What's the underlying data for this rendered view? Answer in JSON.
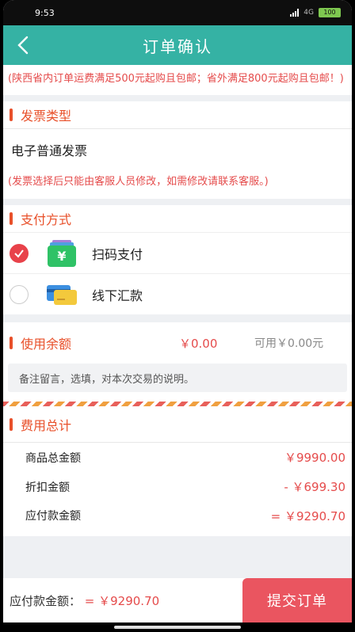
{
  "status": {
    "time": "9:53",
    "network": "4G",
    "battery": "100"
  },
  "header": {
    "title": "订单确认"
  },
  "notice": "(陕西省内订单运费满足500元起购且包邮；省外满足800元起购且包邮！)",
  "invoice": {
    "section_title": "发票类型",
    "type": "电子普通发票",
    "note": "(发票选择后只能由客服人员修改，如需修改请联系客服。)"
  },
  "payment": {
    "section_title": "支付方式",
    "methods": [
      {
        "label": "扫码支付",
        "icon": "yuan-wallet-icon",
        "selected": true
      },
      {
        "label": "线下汇款",
        "icon": "bank-card-icon",
        "selected": false
      }
    ]
  },
  "balance": {
    "label": "使用余额",
    "used": "￥0.00",
    "available": "可用￥0.00元",
    "remark_placeholder": "备注留言，选填，对本次交易的说明。"
  },
  "totals": {
    "section_title": "费用总计",
    "rows": [
      {
        "label": "商品总金额",
        "value": "￥9990.00"
      },
      {
        "label": "折扣金额",
        "value": "- ￥699.30"
      },
      {
        "label": "应付款金额",
        "value": "= ￥9290.70"
      }
    ]
  },
  "footer": {
    "payable_label": "应付款金额：",
    "payable_value": "= ￥9290.70",
    "submit_label": "提交订单"
  },
  "colors": {
    "header": "#35b2a4",
    "accent": "#e8502a",
    "price": "#e54b4b",
    "submit": "#ea5560"
  }
}
